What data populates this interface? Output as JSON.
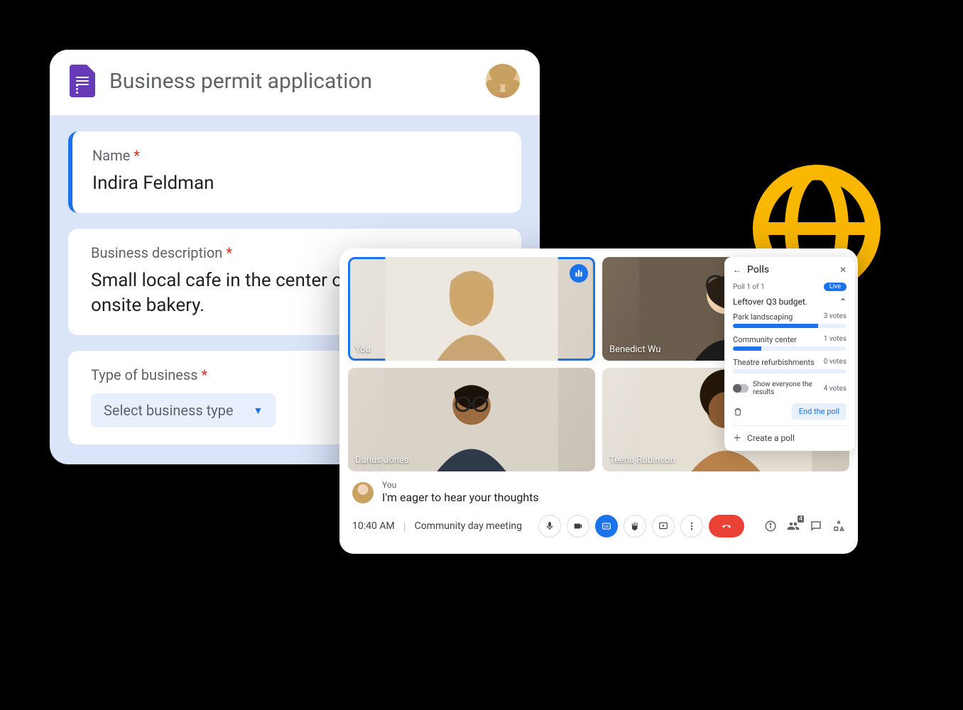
{
  "form": {
    "title": "Business permit application",
    "questions": {
      "name": {
        "label": "Name",
        "value": "Indira Feldman"
      },
      "desc": {
        "label": "Business description",
        "value": "Small local cafe in the center of town with an onsite bakery."
      },
      "type": {
        "label": "Type of business",
        "select_placeholder": "Select business type"
      }
    }
  },
  "meet": {
    "time": "10:40 AM",
    "meeting_name": "Community day meeting",
    "participant_count": "4",
    "tiles": [
      {
        "label": "You"
      },
      {
        "label": "Benedict Wu"
      },
      {
        "label": "Darius Jones"
      },
      {
        "label": "Teena Robinson"
      }
    ],
    "caption": {
      "speaker": "You",
      "text": "I'm eager to hear your thoughts"
    }
  },
  "polls": {
    "title": "Polls",
    "counter": "Poll 1 of 1",
    "live_label": "Live",
    "question": "Leftover Q3 budget.",
    "total_votes": "4 votes",
    "options": [
      {
        "label": "Park landscaping",
        "votes": "3 votes",
        "pct": 75
      },
      {
        "label": "Community center",
        "votes": "1 votes",
        "pct": 25
      },
      {
        "label": "Theatre refurbishments",
        "votes": "0 votes",
        "pct": 0
      }
    ],
    "show_results_label": "Show everyone the results",
    "end_label": "End the poll",
    "create_label": "Create a poll"
  }
}
